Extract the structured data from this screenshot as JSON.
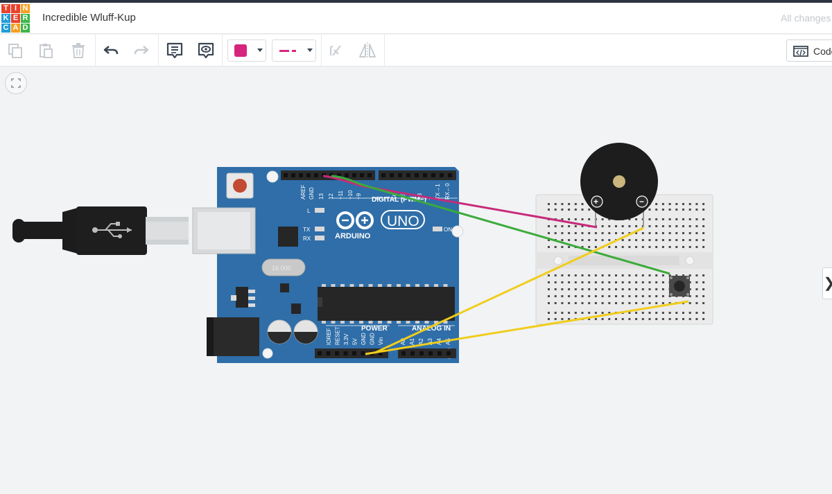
{
  "app": {
    "logo_letters": [
      "T",
      "I",
      "N",
      "K",
      "E",
      "R",
      "C",
      "A",
      "D"
    ],
    "logo_colors": [
      "#e8412c",
      "#e8412c",
      "#f7a021",
      "#1f9dd9",
      "#e8412c",
      "#3db54a",
      "#1f9dd9",
      "#f7a021",
      "#3db54a"
    ],
    "project_title": "Incredible Wluff-Kup",
    "save_status": "All changes"
  },
  "toolbar": {
    "items": [
      {
        "name": "copy-icon",
        "enabled": false
      },
      {
        "name": "paste-icon",
        "enabled": false
      },
      {
        "name": "delete-icon",
        "enabled": false
      },
      {
        "name": "undo-icon",
        "enabled": true
      },
      {
        "name": "redo-icon",
        "enabled": false
      },
      {
        "name": "notes-icon",
        "enabled": true
      },
      {
        "name": "view-icon",
        "enabled": true
      },
      {
        "name": "flip-icon",
        "enabled": false
      },
      {
        "name": "mirror-icon",
        "enabled": false
      }
    ],
    "wire_color": "#d6257d",
    "code_label": "Code"
  },
  "board": {
    "digital_pins": [
      "AREF",
      "GND",
      "13",
      "12",
      "~11",
      "~10",
      "~9",
      "8",
      "7",
      "~6",
      "~5",
      "4",
      "~3",
      "2",
      "TX→1",
      "RX←0"
    ],
    "digital_label": "DIGITAL (PWM~)",
    "power_pins": [
      "IOREF",
      "RESET",
      "3.3V",
      "5V",
      "GND",
      "GND",
      "Vin"
    ],
    "analog_pins": [
      "A0",
      "A1",
      "A2",
      "A3",
      "A4",
      "A5"
    ],
    "power_label": "POWER",
    "analog_label": "ANALOG IN",
    "brand": "ARDUINO",
    "model": "UNO",
    "led_labels": [
      "L",
      "TX",
      "RX"
    ],
    "on_label": "ON",
    "crystal_label": "16.000",
    "color": "#2f6ea8"
  },
  "buzzer": {
    "plus": "+",
    "minus": "−"
  },
  "wires": [
    {
      "name": "magenta",
      "color": "#c72a7a"
    },
    {
      "name": "green",
      "color": "#3bab3b"
    },
    {
      "name": "yellow-a",
      "color": "#f0cd1c"
    },
    {
      "name": "yellow-b",
      "color": "#f0cd1c"
    }
  ]
}
